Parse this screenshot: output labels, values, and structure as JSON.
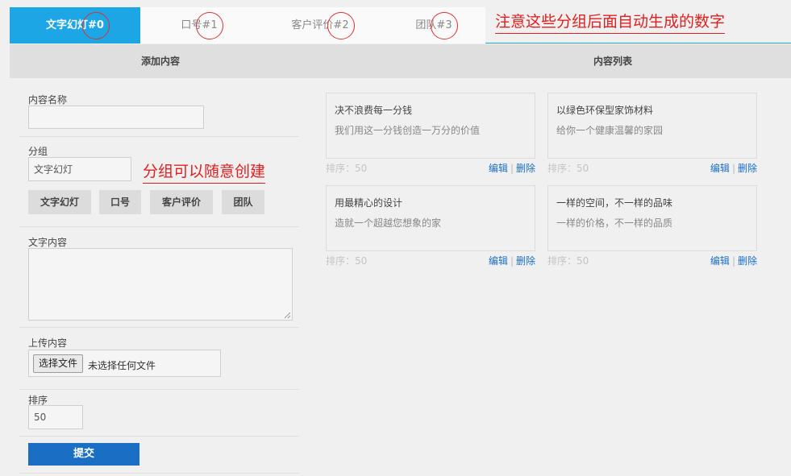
{
  "tabs": [
    {
      "label": "文字幻灯",
      "num": "#0",
      "active": true
    },
    {
      "label": "口号",
      "num": "#1",
      "active": false
    },
    {
      "label": "客户评价",
      "num": "#2",
      "active": false
    },
    {
      "label": "团队",
      "num": "#3",
      "active": false
    }
  ],
  "annotations": {
    "top": "注意这些分组后面自动生成的数字",
    "group": "分组可以随意创建"
  },
  "header": {
    "left": "添加内容",
    "right": "内容列表"
  },
  "form": {
    "name_label": "内容名称",
    "name_value": "",
    "group_label": "分组",
    "group_value": "文字幻灯",
    "group_buttons": [
      "文字幻灯",
      "口号",
      "客户评价",
      "团队"
    ],
    "text_label": "文字内容",
    "text_value": "",
    "upload_label": "上传内容",
    "file_button": "选择文件",
    "file_status": "未选择任何文件",
    "sort_label": "排序",
    "sort_value": "50",
    "submit": "提交"
  },
  "cards": [
    {
      "title": "决不浪费每一分钱",
      "subtitle": "我们用这一分钱创造一万分的价值",
      "sort": "排序：50",
      "edit": "编辑",
      "delete": "删除"
    },
    {
      "title": "以绿色环保型家饰材料",
      "subtitle": "给你一个健康温馨的家园",
      "sort": "排序：50",
      "edit": "编辑",
      "delete": "删除"
    },
    {
      "title": "用最精心的设计",
      "subtitle": "造就一个超越您想象的家",
      "sort": "排序：50",
      "edit": "编辑",
      "delete": "删除"
    },
    {
      "title": "一样的空间，不一样的品味",
      "subtitle": "一样的价格，不一样的品质",
      "sort": "排序：50",
      "edit": "编辑",
      "delete": "删除"
    }
  ],
  "colors": {
    "accent": "#1ca6e6",
    "link": "#1a6fc4",
    "annotation": "#e02020"
  }
}
